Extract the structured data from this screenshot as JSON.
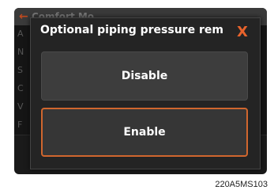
{
  "background_screen": {
    "header_title": "Comfort Mo...",
    "rows": [
      "A",
      "N",
      "S",
      "C",
      "V",
      "F"
    ]
  },
  "dialog": {
    "title": "Optional piping pressure rem",
    "close_symbol": "X",
    "options": [
      {
        "label": "Disable",
        "selected": false
      },
      {
        "label": "Enable",
        "selected": true
      }
    ]
  },
  "caption": "220A5MS103",
  "colors": {
    "accent": "#e8632c",
    "panel": "#242424",
    "button": "#3d3d3d"
  }
}
